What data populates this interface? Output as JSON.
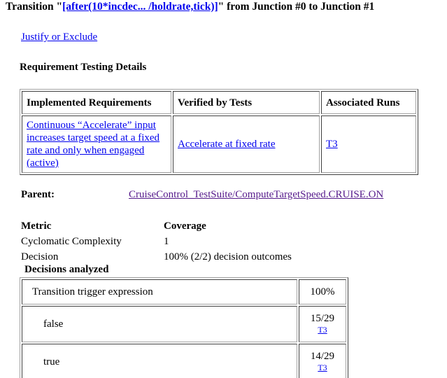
{
  "header": {
    "prefix": "Transition \"",
    "transition_link": "[after(10*incdec... /holdrate,tick)]",
    "suffix": "\" from Junction #0 to Junction #1"
  },
  "justify_link": "Justify or Exclude",
  "requirements": {
    "heading": "Requirement Testing Details",
    "columns": [
      "Implemented Requirements",
      "Verified by Tests",
      "Associated Runs"
    ],
    "rows": [
      {
        "requirement": "Continuous “Accelerate” input increases target speed at a fixed rate and only when engaged (active)",
        "test": "Accelerate at fixed rate",
        "run": "T3"
      }
    ]
  },
  "parent": {
    "label": "Parent:",
    "link": "CruiseControl_TestSuite/ComputeTargetSpeed.CRUISE.ON"
  },
  "metrics": {
    "header": {
      "metric": "Metric",
      "coverage": "Coverage"
    },
    "rows": [
      {
        "metric": "Cyclomatic Complexity",
        "coverage": "1"
      },
      {
        "metric": "Decision",
        "coverage": "100% (2/2) decision outcomes"
      }
    ]
  },
  "decisions": {
    "heading": "Decisions analyzed",
    "expression": {
      "label": "Transition trigger expression",
      "value": "100%"
    },
    "outcomes": [
      {
        "label": "false",
        "count": "15/29",
        "run": "T3"
      },
      {
        "label": "true",
        "count": "14/29",
        "run": "T3"
      }
    ]
  },
  "colors": {
    "link": "#0000ee",
    "visited_link": "#551a8b",
    "text": "#000000"
  }
}
